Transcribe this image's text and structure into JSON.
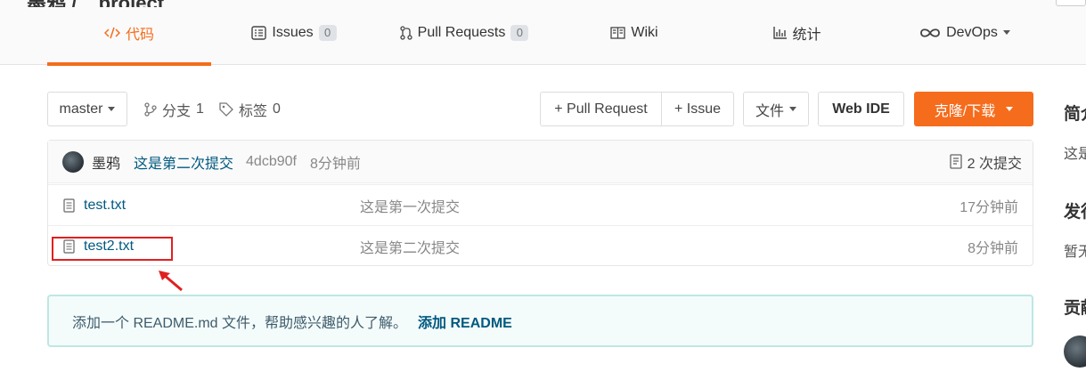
{
  "header": {
    "title_fragment": "墨鸦 / _ project",
    "tabs": [
      {
        "label": "代码",
        "icon": "code-icon",
        "active": true
      },
      {
        "label": "Issues",
        "count": "0",
        "icon": "issues-icon"
      },
      {
        "label": "Pull Requests",
        "count": "0",
        "icon": "pull-request-icon"
      },
      {
        "label": "Wiki",
        "icon": "book-icon"
      },
      {
        "label": "统计",
        "icon": "chart-icon"
      },
      {
        "label": "DevOps",
        "icon": "infinity-icon"
      }
    ]
  },
  "toolbar": {
    "branch": "master",
    "branches_label": "分支",
    "branches_count": "1",
    "tags_label": "标签",
    "tags_count": "0",
    "pull_request_button": "+ Pull Request",
    "issue_button": "+ Issue",
    "file_button": "文件",
    "web_ide_button": "Web IDE",
    "clone_button": "克隆/下载"
  },
  "latest_commit": {
    "author": "墨鸦",
    "message": "这是第二次提交",
    "hash": "4dcb90f",
    "time": "8分钟前",
    "commits_count_label": "2 次提交"
  },
  "files": [
    {
      "name": "test.txt",
      "commit_message": "这是第一次提交",
      "time": "17分钟前"
    },
    {
      "name": "test2.txt",
      "commit_message": "这是第二次提交",
      "time": "8分钟前"
    }
  ],
  "readme_notice": {
    "text": "添加一个 README.md 文件，帮助感兴趣的人了解。",
    "link": "添加 README"
  },
  "sidebar": {
    "intro_heading": "简介",
    "intro_text": "这是",
    "releases_heading": "发行",
    "releases_text": "暂无",
    "contributors_heading": "贡献"
  },
  "colors": {
    "accent": "#f56c1c",
    "link": "#005980",
    "annotation": "#e02020"
  }
}
